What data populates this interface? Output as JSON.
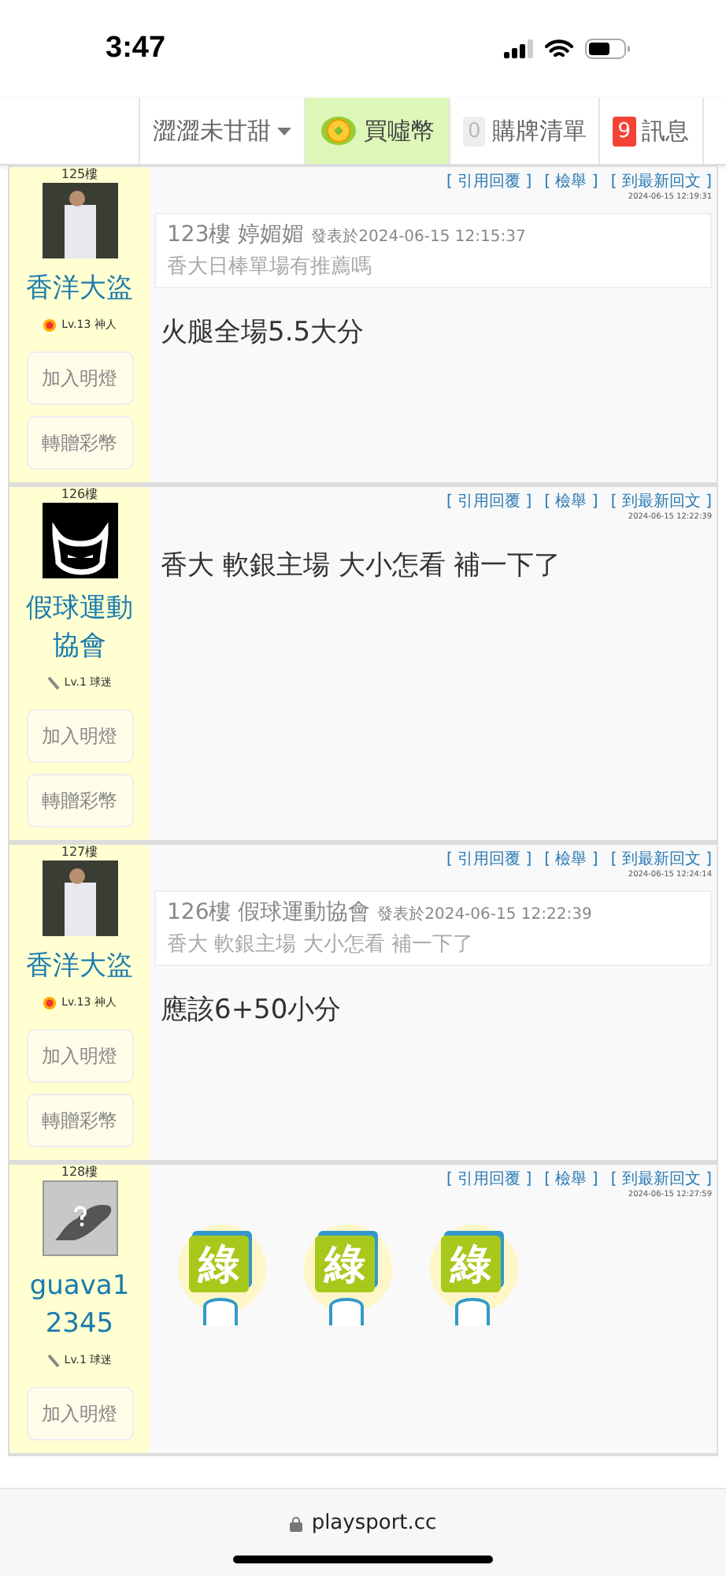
{
  "status_bar": {
    "time": "3:47"
  },
  "nav": [
    {
      "kind": "dropdown",
      "label": "澀澀未甘甜"
    },
    {
      "kind": "coin",
      "label": "買噓幣"
    },
    {
      "kind": "count",
      "badge": "0",
      "color": "#eeeeee",
      "label": "購牌清單"
    },
    {
      "kind": "count",
      "badge": "9",
      "color": "#f44336",
      "label": "訊息"
    }
  ],
  "posts": [
    {
      "floor": "125樓",
      "avatar": {
        "kind": "photo"
      },
      "name": "香洋大盜",
      "level": {
        "kind": "sun",
        "text": "Lv.13 神人"
      },
      "buttons": [
        "加入明燈",
        "轉贈彩幣"
      ],
      "links": [
        "[ 引用回覆 ]",
        "[ 檢舉 ]",
        "[ 到最新回文 ]"
      ],
      "time": "2024-06-15 12:19:31",
      "quote": {
        "head": "123樓 婷媚媚",
        "meta": "發表於2024-06-15 12:15:37",
        "text": "香大日棒單場有推薦嗎"
      },
      "body": "火腿全場5.5大分"
    },
    {
      "floor": "126樓",
      "avatar": {
        "kind": "devil"
      },
      "name": "假球運動協會",
      "level": {
        "kind": "pencil",
        "text": "Lv.1 球迷"
      },
      "buttons": [
        "加入明燈",
        "轉贈彩幣"
      ],
      "links": [
        "[ 引用回覆 ]",
        "[ 檢舉 ]",
        "[ 到最新回文 ]"
      ],
      "time": "2024-06-15 12:22:39",
      "body": "香大 軟銀主場 大小怎看 補一下了"
    },
    {
      "floor": "127樓",
      "avatar": {
        "kind": "photo"
      },
      "name": "香洋大盜",
      "level": {
        "kind": "sun",
        "text": "Lv.13 神人"
      },
      "buttons": [
        "加入明燈",
        "轉贈彩幣"
      ],
      "links": [
        "[ 引用回覆 ]",
        "[ 檢舉 ]",
        "[ 到最新回文 ]"
      ],
      "time": "2024-06-15 12:24:14",
      "quote": {
        "head": "126樓 假球運動協會",
        "meta": "發表於2024-06-15 12:22:39",
        "text": "香大 軟銀主場 大小怎看 補一下了"
      },
      "body": "應該6+50小分"
    },
    {
      "floor": "128樓",
      "avatar": {
        "kind": "unknown"
      },
      "name": "guava12345",
      "level": {
        "kind": "pencil",
        "text": "Lv.1 球迷"
      },
      "buttons": [
        "加入明燈"
      ],
      "links": [
        "[ 引用回覆 ]",
        "[ 檢舉 ]",
        "[ 到最新回文 ]"
      ],
      "time": "2024-06-15 12:27:59",
      "stickers": [
        "綠",
        "綠",
        "綠"
      ]
    }
  ],
  "browser_bar": {
    "url": "playsport.cc"
  }
}
